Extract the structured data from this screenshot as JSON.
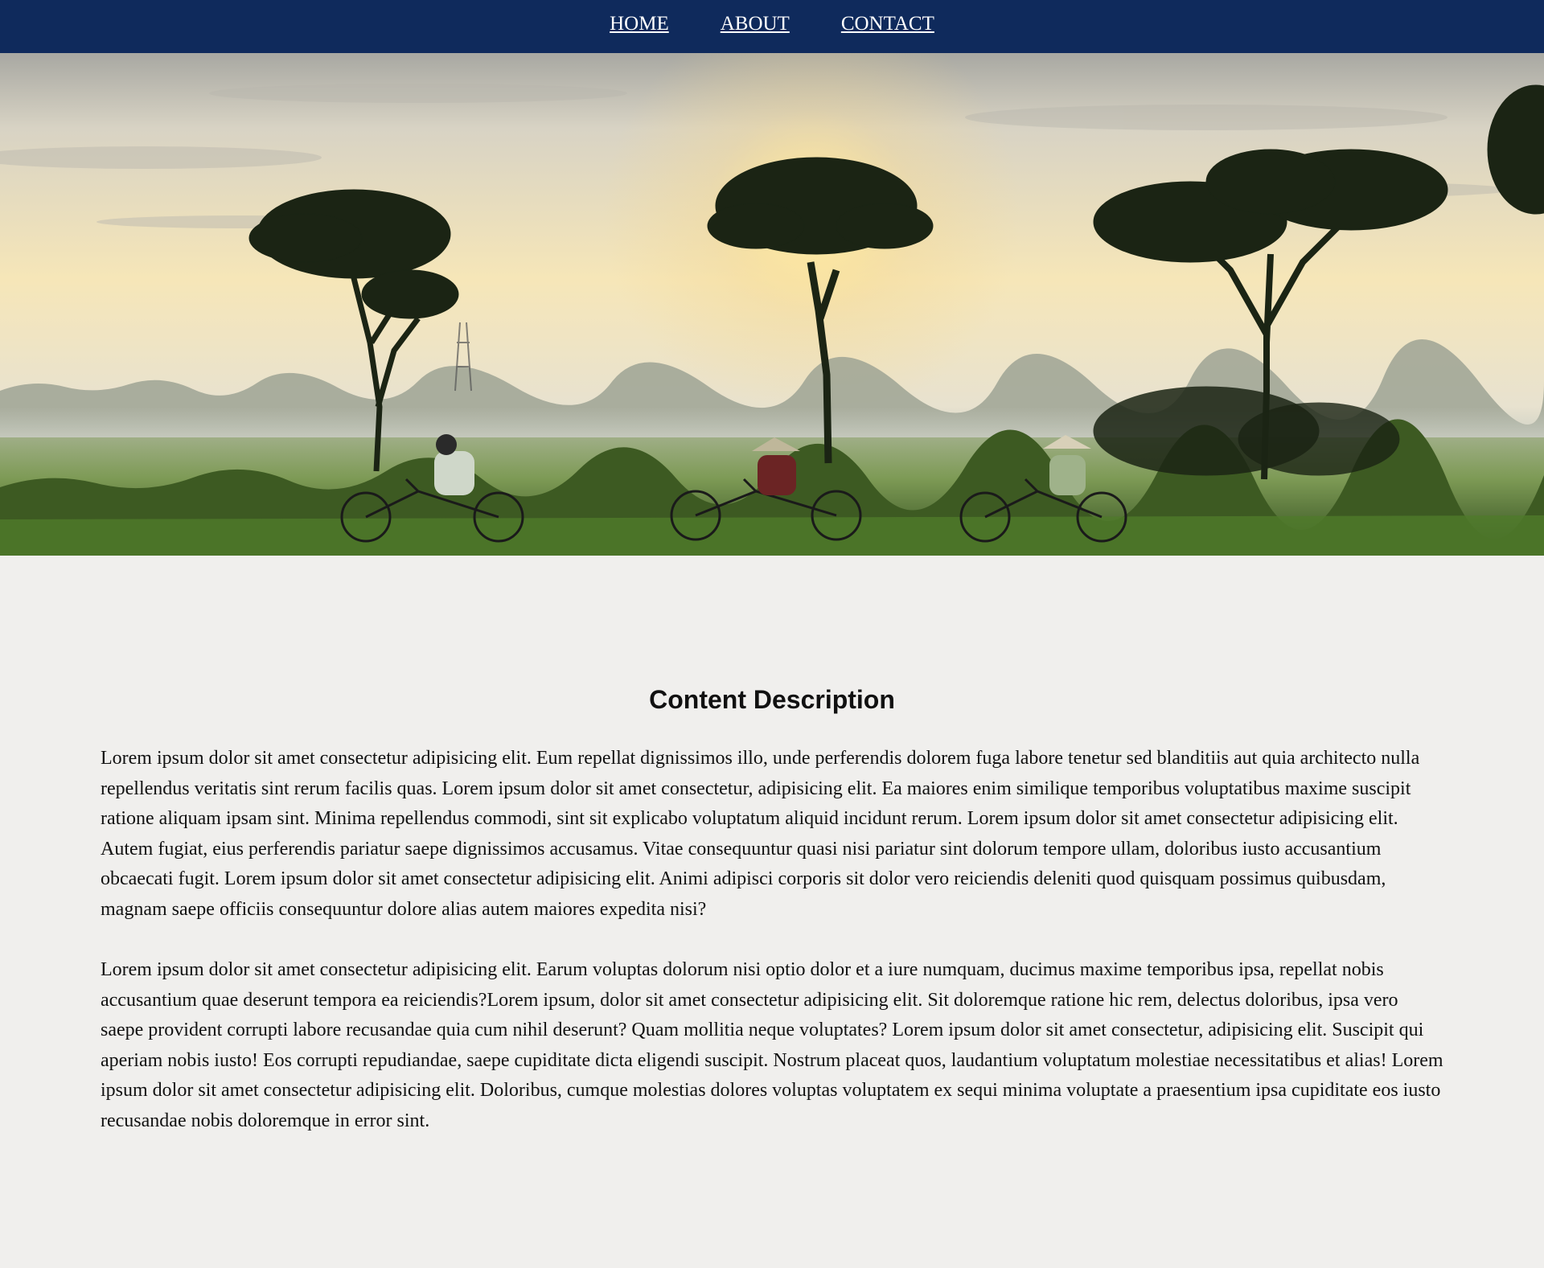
{
  "nav": {
    "items": [
      {
        "label": "HOME"
      },
      {
        "label": "ABOUT"
      },
      {
        "label": "CONTACT"
      }
    ]
  },
  "colors": {
    "nav_background": "#0f2a5c",
    "page_background": "#f0efed",
    "nav_text": "#ffffff"
  },
  "hero": {
    "image_icon": "landscape-photo-icon"
  },
  "content": {
    "title": "Content Description",
    "paragraphs": [
      "Lorem ipsum dolor sit amet consectetur adipisicing elit. Eum repellat dignissimos illo, unde perferendis dolorem fuga labore tenetur sed blanditiis aut quia architecto nulla repellendus veritatis sint rerum facilis quas. Lorem ipsum dolor sit amet consectetur, adipisicing elit. Ea maiores enim similique temporibus voluptatibus maxime suscipit ratione aliquam ipsam sint. Minima repellendus commodi, sint sit explicabo voluptatum aliquid incidunt rerum. Lorem ipsum dolor sit amet consectetur adipisicing elit. Autem fugiat, eius perferendis pariatur saepe dignissimos accusamus. Vitae consequuntur quasi nisi pariatur sint dolorum tempore ullam, doloribus iusto accusantium obcaecati fugit. Lorem ipsum dolor sit amet consectetur adipisicing elit. Animi adipisci corporis sit dolor vero reiciendis deleniti quod quisquam possimus quibusdam, magnam saepe officiis consequuntur dolore alias autem maiores expedita nisi?",
      "Lorem ipsum dolor sit amet consectetur adipisicing elit. Earum voluptas dolorum nisi optio dolor et a iure numquam, ducimus maxime temporibus ipsa, repellat nobis accusantium quae deserunt tempora ea reiciendis?Lorem ipsum, dolor sit amet consectetur adipisicing elit. Sit doloremque ratione hic rem, delectus doloribus, ipsa vero saepe provident corrupti labore recusandae quia cum nihil deserunt? Quam mollitia neque voluptates? Lorem ipsum dolor sit amet consectetur, adipisicing elit. Suscipit qui aperiam nobis iusto! Eos corrupti repudiandae, saepe cupiditate dicta eligendi suscipit. Nostrum placeat quos, laudantium voluptatum molestiae necessitatibus et alias! Lorem ipsum dolor sit amet consectetur adipisicing elit. Doloribus, cumque molestias dolores voluptas voluptatem ex sequi minima voluptate a praesentium ipsa cupiditate eos iusto recusandae nobis doloremque in error sint."
    ]
  }
}
